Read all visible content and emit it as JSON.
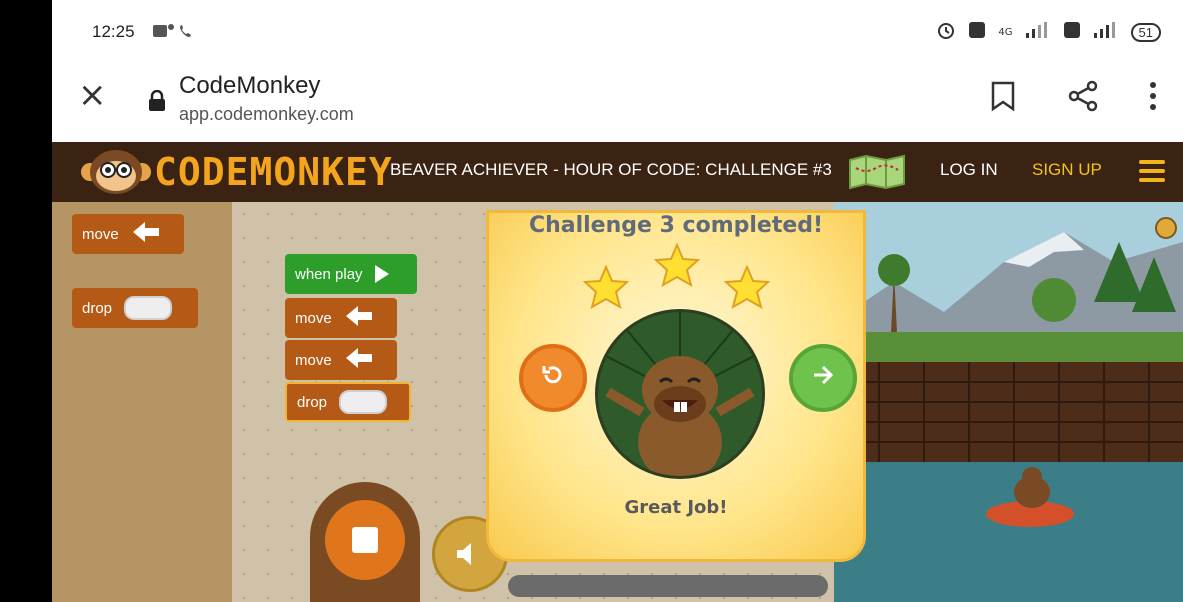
{
  "status_bar": {
    "time": "12:25",
    "battery": "51",
    "network": "4G"
  },
  "browser": {
    "close_label": "×",
    "site_title": "CodeMonkey",
    "site_url": "app.codemonkey.com"
  },
  "app_header": {
    "logo_text": "CODEMONKEY",
    "challenge_title": "BEAVER ACHIEVER - HOUR OF CODE: CHALLENGE #3",
    "login_label": "LOG IN",
    "signup_label": "SIGN UP"
  },
  "palette": {
    "blocks": [
      {
        "label": "move"
      },
      {
        "label": "drop"
      }
    ]
  },
  "editor": {
    "start_block": "when play",
    "blocks": [
      {
        "label": "move"
      },
      {
        "label": "move"
      },
      {
        "label": "drop"
      }
    ]
  },
  "modal": {
    "title": "Challenge 3 completed!",
    "stars_earned": 3,
    "stars_total": 3,
    "message": "Great Job!"
  },
  "colors": {
    "header_bg": "#3b2314",
    "logo": "#f4a51c",
    "signup": "#f4c21c",
    "block_orange": "#b55a16",
    "block_green": "#2e9e2a",
    "retry": "#f08a2c",
    "next": "#6fc24b"
  }
}
